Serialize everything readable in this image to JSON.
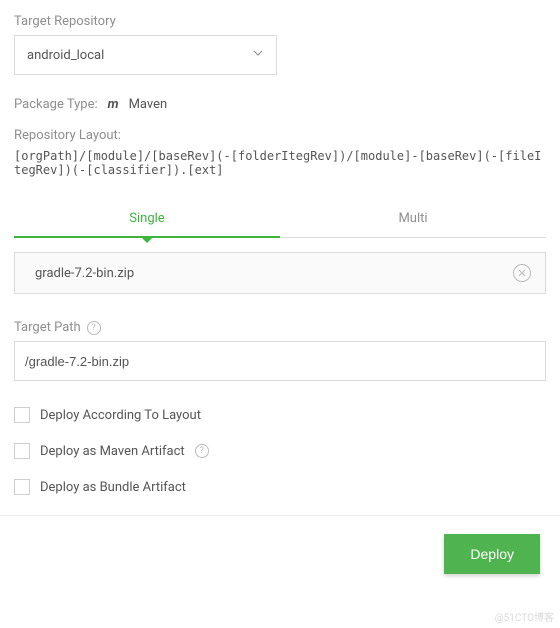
{
  "target_repo": {
    "label": "Target Repository",
    "value": "android_local"
  },
  "package_type": {
    "label": "Package Type:",
    "icon": "m",
    "value": "Maven"
  },
  "repo_layout": {
    "label": "Repository Layout:",
    "value": "[orgPath]/[module]/[baseRev](-[folderItegRev])/[module]-[baseRev](-[fileItegRev])(-[classifier]).[ext]"
  },
  "tabs": {
    "single": "Single",
    "multi": "Multi"
  },
  "file": {
    "name": "gradle-7.2-bin.zip"
  },
  "target_path": {
    "label": "Target Path",
    "value": "/gradle-7.2-bin.zip"
  },
  "checkboxes": {
    "deploy_layout": "Deploy According To Layout",
    "deploy_maven": "Deploy as Maven Artifact",
    "deploy_bundle": "Deploy as Bundle Artifact"
  },
  "buttons": {
    "deploy": "Deploy"
  },
  "watermark": "@51CTO博客"
}
